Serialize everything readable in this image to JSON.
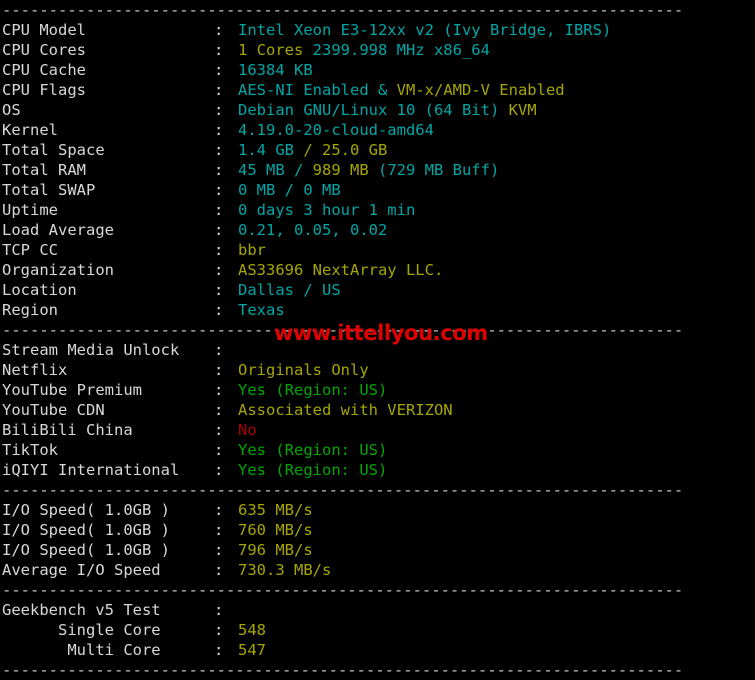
{
  "terminal": {
    "title": "VPS Benchmark Output",
    "background_color": "#000000",
    "separator_char": "-",
    "colon": ":",
    "palette": {
      "label": "#d8d8d8",
      "cyan": "#00a6a6",
      "yellow": "#a6a600",
      "green": "#00a600",
      "red": "#a60000",
      "watermark_red": "#e00000",
      "separator": "#c8c8c8"
    }
  },
  "watermark": {
    "text": "www.ittellyou.com",
    "color": "#e00000"
  },
  "separators": {
    "top": "-------------------------------------------------------------------------",
    "after_region": "-------------------------------------------------------------------------",
    "after_iqiyi": "-------------------------------------------------------------------------",
    "after_io": "-------------------------------------------------------------------------",
    "bottom": "-------------------------------------------------------------------------"
  },
  "sections": [
    {
      "name": "system-info",
      "rows": [
        {
          "label": "CPU Model",
          "segments": [
            {
              "text": "Intel Xeon E3-12xx v2 (Ivy Bridge, IBRS)",
              "color": "cyan"
            }
          ]
        },
        {
          "label": "CPU Cores",
          "segments": [
            {
              "text": "1 Cores ",
              "color": "yellow"
            },
            {
              "text": "2399.998 MHz x86_64",
              "color": "cyan"
            }
          ]
        },
        {
          "label": "CPU Cache",
          "segments": [
            {
              "text": "16384 KB",
              "color": "cyan"
            }
          ]
        },
        {
          "label": "CPU Flags",
          "segments": [
            {
              "text": "AES-NI Enabled ",
              "color": "cyan"
            },
            {
              "text": "& ",
              "color": "cyan"
            },
            {
              "text": "VM-x/AMD-V Enabled",
              "color": "yellow"
            }
          ]
        },
        {
          "label": "OS",
          "segments": [
            {
              "text": "Debian GNU/Linux 10 (64 Bit) ",
              "color": "cyan"
            },
            {
              "text": "KVM",
              "color": "yellow"
            }
          ]
        },
        {
          "label": "Kernel",
          "segments": [
            {
              "text": "4.19.0-20-cloud-amd64",
              "color": "cyan"
            }
          ]
        },
        {
          "label": "Total Space",
          "segments": [
            {
              "text": "1.4 GB ",
              "color": "cyan"
            },
            {
              "text": "/ 25.0 GB",
              "color": "yellow"
            }
          ]
        },
        {
          "label": "Total RAM",
          "segments": [
            {
              "text": "45 MB / ",
              "color": "cyan"
            },
            {
              "text": "989 MB",
              "color": "yellow"
            },
            {
              "text": " (729 MB Buff)",
              "color": "cyan"
            }
          ]
        },
        {
          "label": "Total SWAP",
          "segments": [
            {
              "text": "0 MB / 0 MB",
              "color": "cyan"
            }
          ]
        },
        {
          "label": "Uptime",
          "segments": [
            {
              "text": "0 days 3 hour 1 min",
              "color": "cyan"
            }
          ]
        },
        {
          "label": "Load Average",
          "segments": [
            {
              "text": "0.21, 0.05, 0.02",
              "color": "cyan"
            }
          ]
        },
        {
          "label": "TCP CC",
          "segments": [
            {
              "text": "bbr",
              "color": "yellow"
            }
          ]
        },
        {
          "label": "Organization",
          "segments": [
            {
              "text": "AS33696 NextArray LLC.",
              "color": "yellow"
            }
          ]
        },
        {
          "label": "Location",
          "segments": [
            {
              "text": "Dallas / US",
              "color": "cyan"
            }
          ]
        },
        {
          "label": "Region",
          "segments": [
            {
              "text": "Texas",
              "color": "cyan"
            }
          ]
        }
      ]
    },
    {
      "name": "stream-media-unlock",
      "rows": [
        {
          "label": "Stream Media Unlock",
          "segments": []
        },
        {
          "label": "Netflix",
          "segments": [
            {
              "text": "Originals Only",
              "color": "yellow"
            }
          ]
        },
        {
          "label": "YouTube Premium",
          "segments": [
            {
              "text": "Yes (Region: US)",
              "color": "green"
            }
          ]
        },
        {
          "label": "YouTube CDN",
          "segments": [
            {
              "text": "Associated with VERIZON",
              "color": "yellow"
            }
          ]
        },
        {
          "label": "BiliBili China",
          "segments": [
            {
              "text": "No",
              "color": "red"
            }
          ]
        },
        {
          "label": "TikTok",
          "segments": [
            {
              "text": "Yes (Region: US)",
              "color": "green"
            }
          ]
        },
        {
          "label": "iQIYI International",
          "segments": [
            {
              "text": "Yes (Region: US)",
              "color": "green"
            }
          ]
        }
      ]
    },
    {
      "name": "io-speed",
      "rows": [
        {
          "label": "I/O Speed( 1.0GB )",
          "segments": [
            {
              "text": "635 MB/s",
              "color": "yellow"
            }
          ]
        },
        {
          "label": "I/O Speed( 1.0GB )",
          "segments": [
            {
              "text": "760 MB/s",
              "color": "yellow"
            }
          ]
        },
        {
          "label": "I/O Speed( 1.0GB )",
          "segments": [
            {
              "text": "796 MB/s",
              "color": "yellow"
            }
          ]
        },
        {
          "label": "Average I/O Speed",
          "segments": [
            {
              "text": "730.3 MB/s",
              "color": "yellow"
            }
          ]
        }
      ]
    },
    {
      "name": "geekbench",
      "rows": [
        {
          "label": "Geekbench v5 Test",
          "segments": []
        },
        {
          "label": "      Single Core",
          "segments": [
            {
              "text": "548",
              "color": "yellow"
            }
          ]
        },
        {
          "label": "       Multi Core",
          "segments": [
            {
              "text": "547",
              "color": "yellow"
            }
          ]
        }
      ]
    }
  ]
}
